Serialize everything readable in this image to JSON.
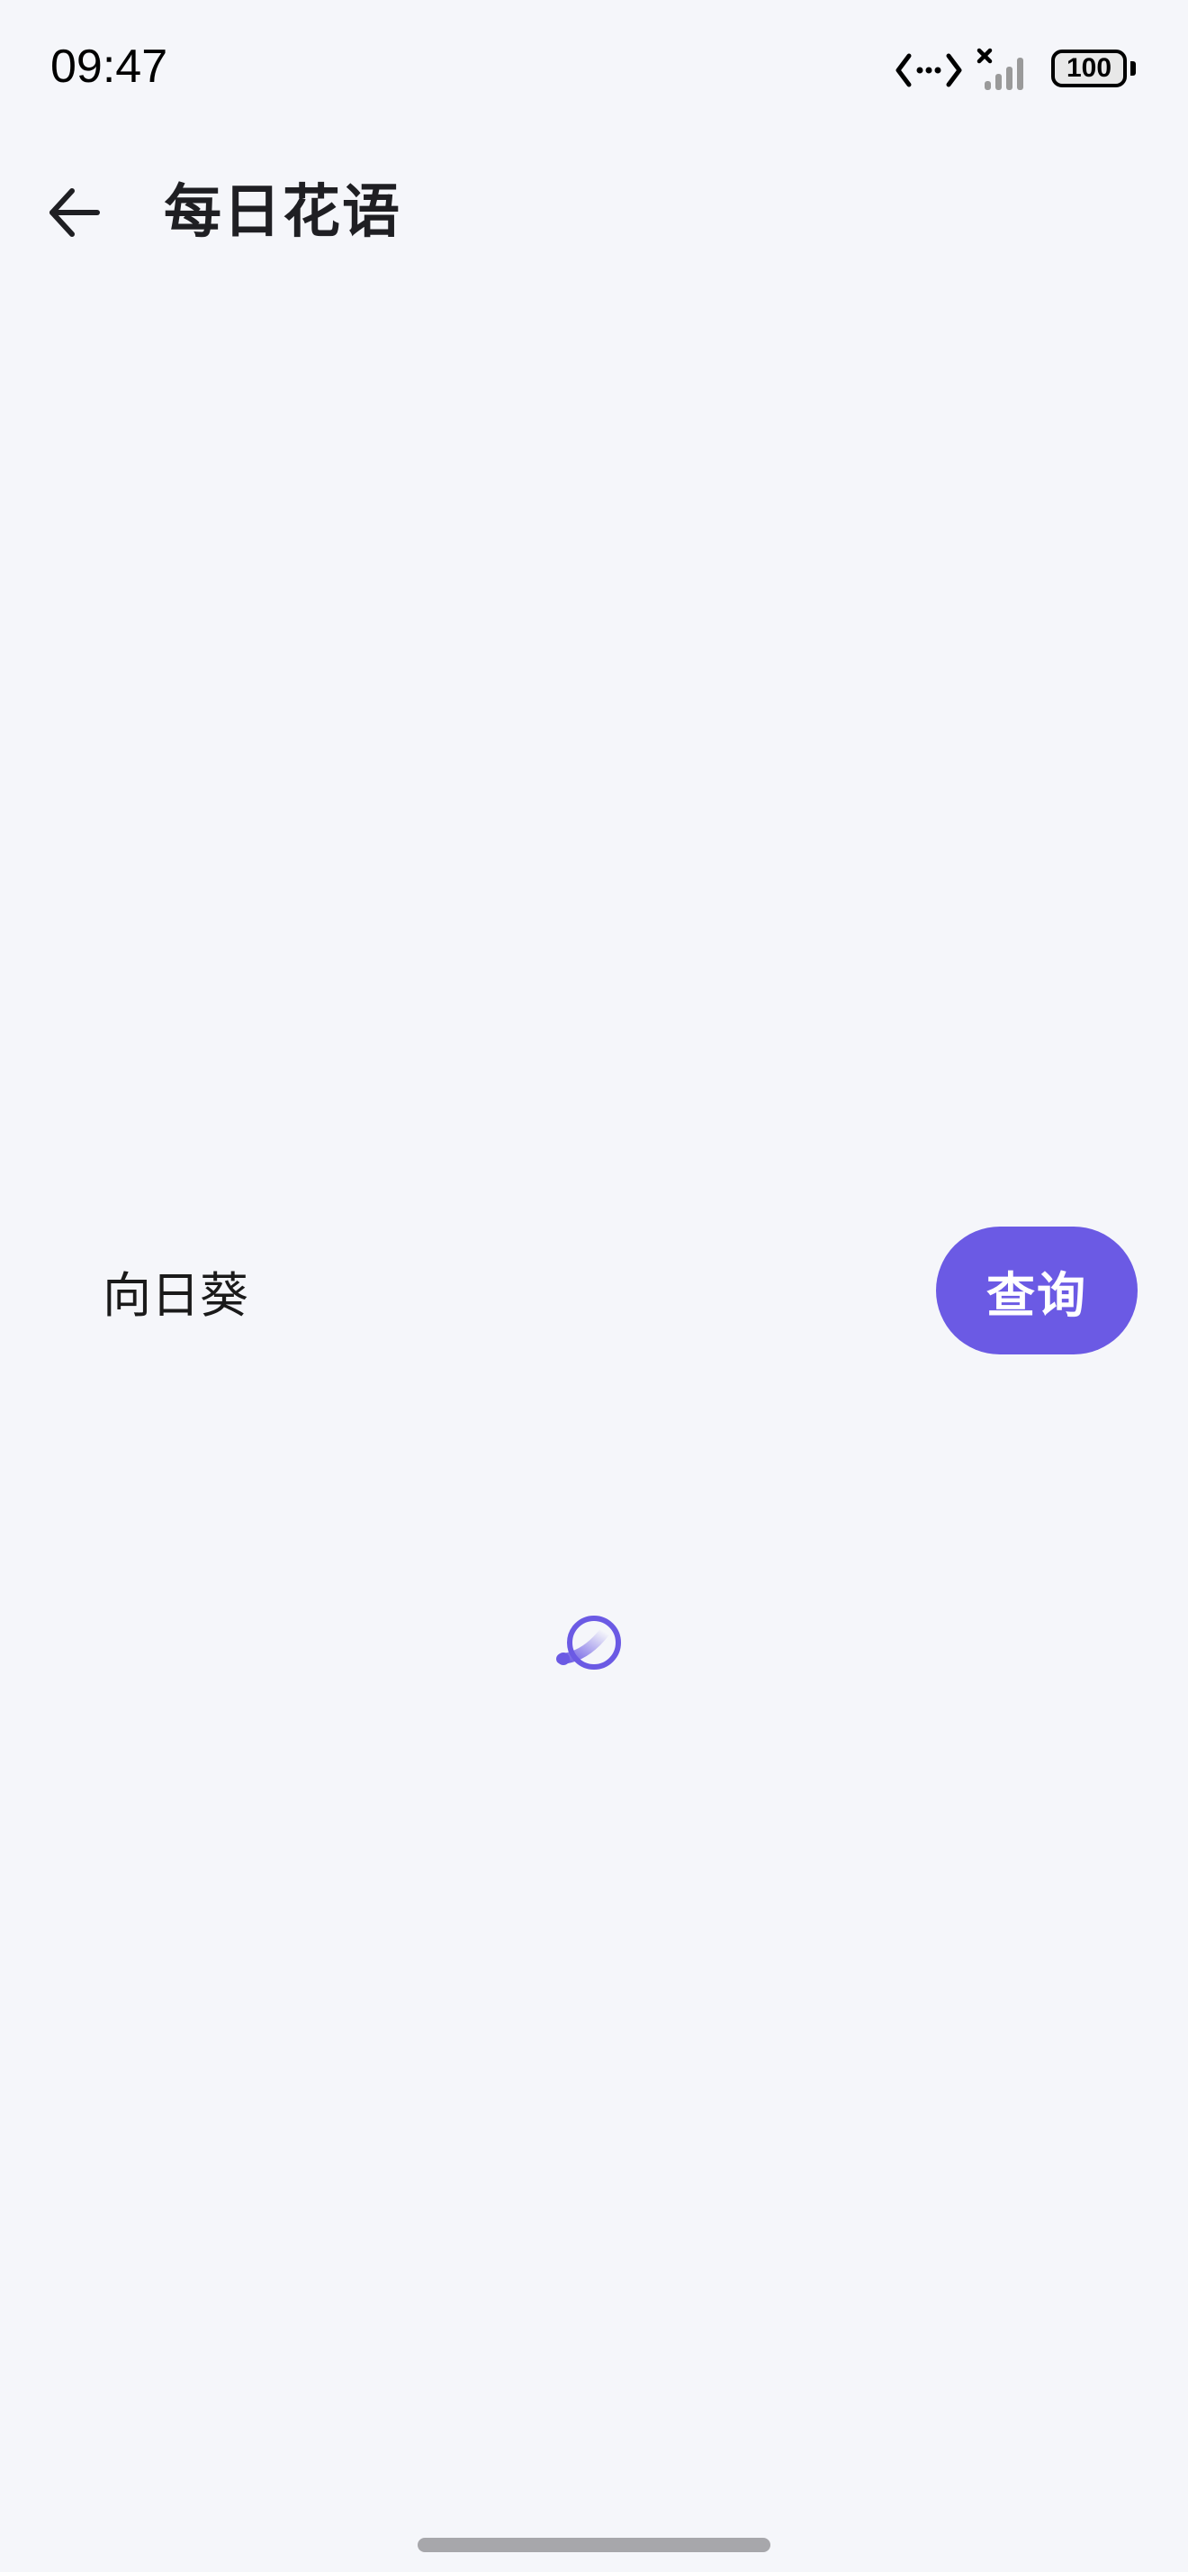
{
  "status_bar": {
    "time": "09:47",
    "battery_level": "100",
    "icons": [
      "data-transfer-icon",
      "no-signal-icon",
      "battery-icon"
    ]
  },
  "app_bar": {
    "back_icon": "arrow-left-icon",
    "title": "每日花语"
  },
  "search": {
    "input_value": "向日葵",
    "button_label": "查询"
  },
  "loading": {
    "icon": "loading-spinner-icon"
  },
  "colors": {
    "background": "#f5f6fa",
    "accent": "#6b5ae4",
    "title_text": "#1f1f23",
    "home_indicator": "#a7a7ab"
  }
}
